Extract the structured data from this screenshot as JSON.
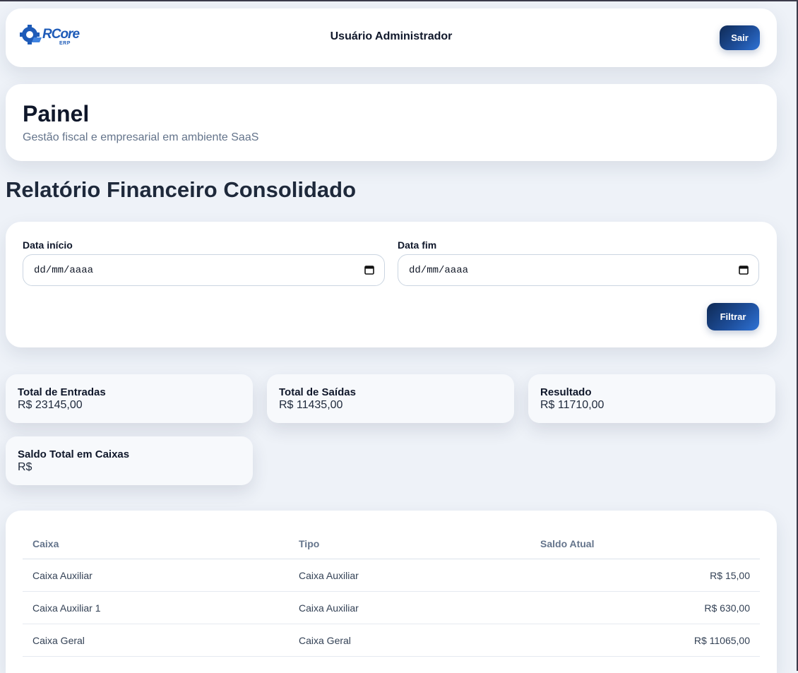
{
  "header": {
    "logo_text": "RCore",
    "logo_sub": "ERP",
    "user_name": "Usuário Administrador",
    "logout_label": "Sair"
  },
  "page": {
    "title": "Painel",
    "subtitle": "Gestão fiscal e empresarial em ambiente SaaS",
    "report_title": "Relatório Financeiro Consolidado"
  },
  "filters": {
    "start_label": "Data início",
    "start_value": "dd/mm/aaaa",
    "end_label": "Data fim",
    "end_value": "dd/mm/aaaa",
    "filter_button": "Filtrar"
  },
  "summary": {
    "entradas": {
      "label": "Total de Entradas",
      "value": "R$ 23145,00"
    },
    "saidas": {
      "label": "Total de Saídas",
      "value": "R$ 11435,00"
    },
    "resultado": {
      "label": "Resultado",
      "value": "R$ 11710,00"
    },
    "saldo": {
      "label": "Saldo Total em Caixas",
      "value": "R$"
    }
  },
  "table": {
    "columns": [
      "Caixa",
      "Tipo",
      "Saldo Atual"
    ],
    "rows": [
      {
        "caixa": "Caixa Auxiliar",
        "tipo": "Caixa Auxiliar",
        "saldo": "R$ 15,00"
      },
      {
        "caixa": "Caixa Auxiliar 1",
        "tipo": "Caixa Auxiliar",
        "saldo": "R$ 630,00"
      },
      {
        "caixa": "Caixa Geral",
        "tipo": "Caixa Geral",
        "saldo": "R$ 11065,00"
      }
    ]
  },
  "colors": {
    "accent_dark": "#0f2a55",
    "accent_light": "#2f73d6",
    "background": "#eef2f8"
  }
}
